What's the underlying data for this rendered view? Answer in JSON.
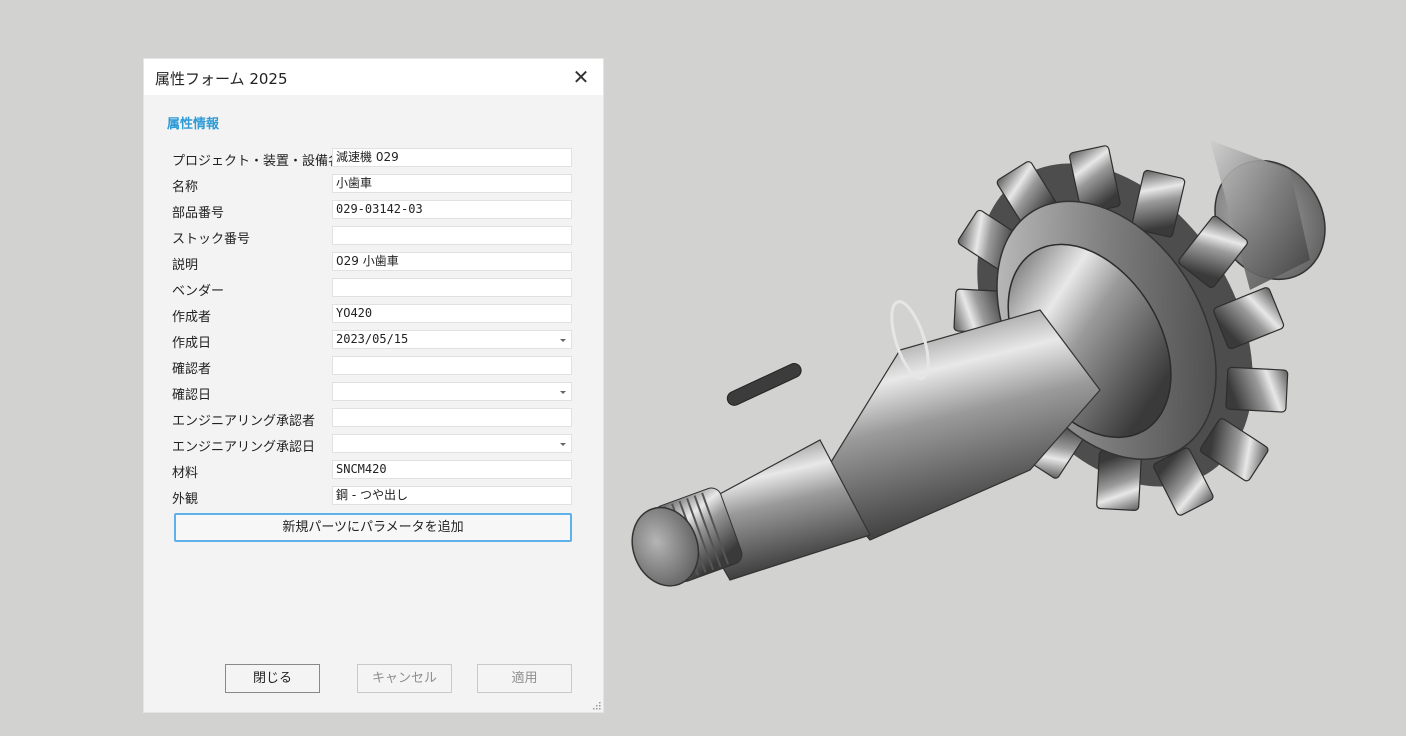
{
  "dialog": {
    "title": "属性フォーム 2025",
    "close_glyph": "✕",
    "section_title": "属性情報",
    "fields": [
      {
        "label": "プロジェクト・装置・設備名",
        "value": "減速機 029",
        "dropdown": false
      },
      {
        "label": "名称",
        "value": "小歯車",
        "dropdown": false
      },
      {
        "label": "部品番号",
        "value": "029-03142-03",
        "dropdown": false
      },
      {
        "label": "ストック番号",
        "value": "",
        "dropdown": false
      },
      {
        "label": "説明",
        "value": "029 小歯車",
        "dropdown": false
      },
      {
        "label": "ベンダー",
        "value": "",
        "dropdown": false
      },
      {
        "label": "作成者",
        "value": "YO420",
        "dropdown": false
      },
      {
        "label": "作成日",
        "value": "2023/05/15",
        "dropdown": true
      },
      {
        "label": "確認者",
        "value": "",
        "dropdown": false
      },
      {
        "label": "確認日",
        "value": "",
        "dropdown": true
      },
      {
        "label": "エンジニアリング承認者",
        "value": "",
        "dropdown": false
      },
      {
        "label": "エンジニアリング承認日",
        "value": "",
        "dropdown": true
      },
      {
        "label": "材料",
        "value": "SNCM420",
        "dropdown": false
      },
      {
        "label": "外観",
        "value": "鋼 - つや出し",
        "dropdown": false
      }
    ],
    "add_param_button": "新規パーツにパラメータを追加",
    "buttons": {
      "close": "閉じる",
      "cancel": "キャンセル",
      "apply": "適用"
    }
  },
  "colors": {
    "viewport_bg": "#d2d3d0",
    "dialog_bg": "#f3f3f3",
    "section_accent": "#2f9bd6",
    "focus_border": "#5eb1ea"
  },
  "model_view": {
    "object": "helical pinion gear shaft"
  }
}
